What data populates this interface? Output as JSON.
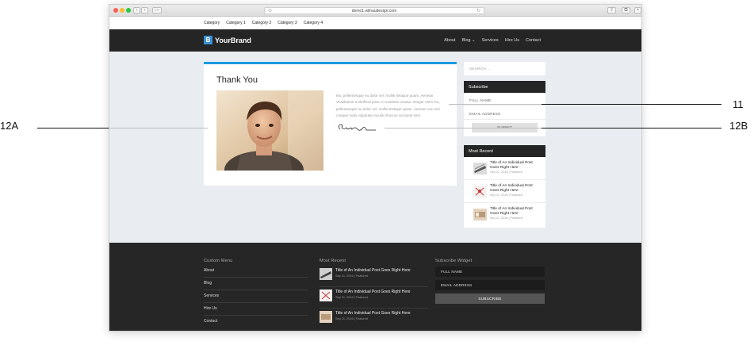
{
  "browser": {
    "url": "demo1.wilnaudesign.com",
    "lock_glyph": "⊙",
    "reload_glyph": "↻",
    "back_glyph": "‹",
    "forward_glyph": "›",
    "share_glyph": "⇪",
    "tabs_glyph": "⧉",
    "add_glyph": "+"
  },
  "site": {
    "categories": [
      "Category",
      "Category 1",
      "Category 2",
      "Category 3",
      "Category 4"
    ],
    "logo_letter": "B",
    "brand": "YourBrand",
    "nav": [
      "About",
      "Blog",
      "Services",
      "Hire Us",
      "Contact"
    ],
    "blog_caret": "⌄",
    "accent": "#1d9be0"
  },
  "card": {
    "title": "Thank You",
    "body": "leo, pellentesque eu dolor vel, mollis tristique quam. Aenean. Vestibulum a eleifend justo, in molestie massa. Integer enim leo, pellentesque eu dolor vel, mollis tristique quam. Aenean non nisi congue nulla vulputate iaculis rhoncus vel amet sem."
  },
  "sidebar": {
    "search_placeholder": "SEARCH ...",
    "subscribe": {
      "heading": "Subscribe",
      "full_name": "FULL NAME",
      "email": "EMAIL ADDRESS",
      "submit": "SUBMIT"
    },
    "recent": {
      "heading": "Most Recent",
      "posts": [
        {
          "title": "Title of An Individual Post Goes Right Here",
          "meta": "Sep 21, 2016 | Featured"
        },
        {
          "title": "Title of An Individual Post Goes Right Here",
          "meta": "Sep 21, 2016 | Featured"
        },
        {
          "title": "Title of An Individual Post Goes Right Here",
          "meta": "Sep 21, 2016 | Featured"
        }
      ]
    }
  },
  "footer": {
    "menu_title": "Custom Menu",
    "menu": [
      "About",
      "Blog",
      "Services",
      "Hire Us",
      "Contact"
    ],
    "recent_title": "Most Recent",
    "recent": [
      {
        "title": "Title of An Individual Post Goes Right Here",
        "meta": "Sep 21, 2016 | Featured"
      },
      {
        "title": "Title of An Individual Post Goes Right Here",
        "meta": "Sep 21, 2016 | Featured"
      },
      {
        "title": "Title of An Individual Post Goes Right Here",
        "meta": "Sep 21, 2016 | Featured"
      }
    ],
    "subscribe_title": "Subscribe Widget",
    "full_name": "FULL NAME",
    "email": "EMAIL ADDRESS",
    "submit": "SUBSCRIBE"
  },
  "callouts": {
    "left": "12A",
    "right_top": "11",
    "right_bottom": "12B"
  }
}
